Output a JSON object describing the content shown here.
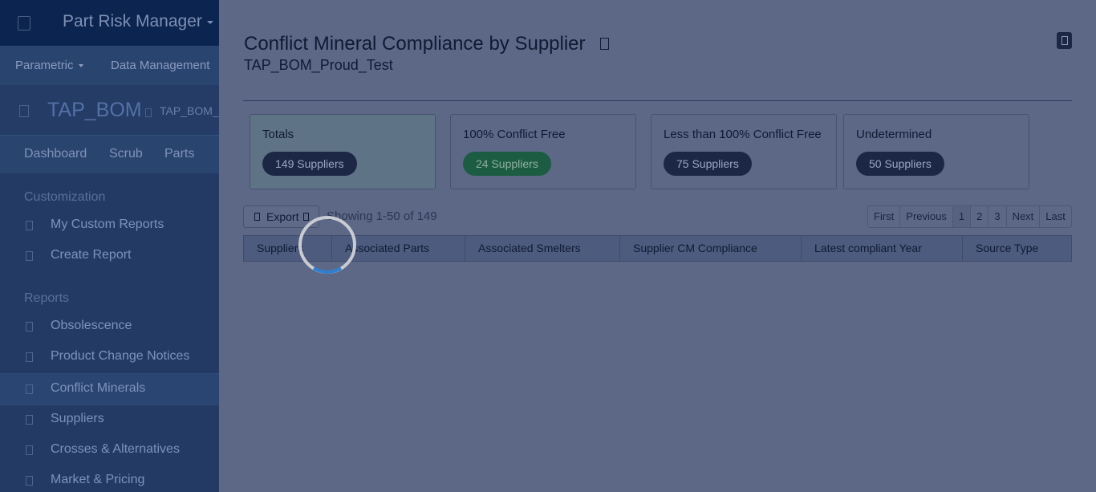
{
  "app": {
    "title": "Part Risk Manager"
  },
  "menubar": {
    "items": [
      "Parametric",
      "Data Management"
    ]
  },
  "bom": {
    "title": "TAP_BOM",
    "subtitle": "TAP_BOM_"
  },
  "tabs": [
    "Dashboard",
    "Scrub",
    "Parts"
  ],
  "sidebar": {
    "customization_label": "Customization",
    "customization_items": [
      "My Custom Reports",
      "Create Report"
    ],
    "reports_label": "Reports",
    "report_items": [
      "Obsolescence",
      "Product Change Notices",
      "Conflict Minerals",
      "Suppliers",
      "Crosses & Alternatives",
      "Market & Pricing"
    ],
    "active_item": "Conflict Minerals"
  },
  "report": {
    "title": "Conflict Mineral Compliance by Supplier",
    "subtitle": "TAP_BOM_Proud_Test"
  },
  "stats": [
    {
      "label": "Totals",
      "value": "149 Suppliers",
      "color": "#1c2745"
    },
    {
      "label": "100% Conflict Free",
      "value": "24 Suppliers",
      "color": "#1c5c43"
    },
    {
      "label": "Less than 100% Conflict Free",
      "value": "75 Suppliers",
      "color": "#1c2745"
    },
    {
      "label": "Undetermined",
      "value": "50 Suppliers",
      "color": "#1c2745"
    }
  ],
  "toolbar": {
    "export_label": "Export",
    "showing_text": "Showing 1-50 of 149"
  },
  "pagination": {
    "pages": [
      "First",
      "Previous",
      "1",
      "2",
      "3",
      "Next",
      "Last"
    ],
    "current": "1"
  },
  "table": {
    "columns": [
      "Suppliers",
      "Associated Parts",
      "Associated Smelters",
      "Supplier CM Compliance",
      "Latest compliant Year",
      "Source Type"
    ]
  },
  "colors": {
    "overlay": "#5c6886",
    "sidebar": "#233b64",
    "topbar": "#0b2450",
    "spinner_track": "#c8cbd2",
    "spinner_accent": "#2f7fcf"
  },
  "loading": true
}
